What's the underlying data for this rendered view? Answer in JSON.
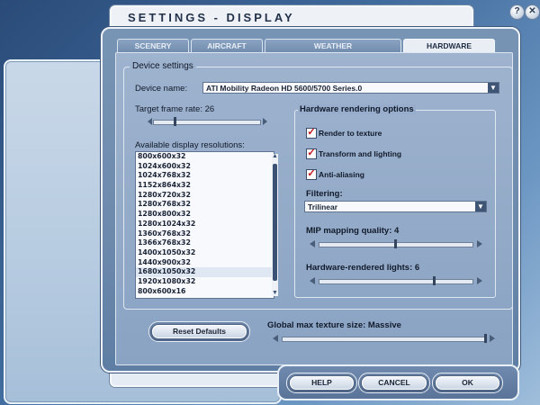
{
  "dialog": {
    "title": "SETTINGS - DISPLAY",
    "help_icon": "question-mark",
    "close_icon": "close-x"
  },
  "tabs": [
    {
      "label": "SCENERY",
      "active": false
    },
    {
      "label": "AIRCRAFT",
      "active": false
    },
    {
      "label": "WEATHER",
      "active": false
    },
    {
      "label": "HARDWARE",
      "active": true
    }
  ],
  "device_settings": {
    "group_label": "Device settings",
    "device_name_label": "Device name:",
    "device_name_value": "ATI Mobility Radeon HD 5600/5700 Series.0",
    "target_frame_rate_label": "Target frame rate: 26",
    "target_frame_rate_level": 0.2,
    "available_resolutions_label": "Available display resolutions:",
    "resolutions": [
      "800x600x32",
      "1024x600x32",
      "1024x768x32",
      "1152x864x32",
      "1280x720x32",
      "1280x768x32",
      "1280x800x32",
      "1280x1024x32",
      "1360x768x32",
      "1366x768x32",
      "1400x1050x32",
      "1440x900x32",
      "1680x1050x32",
      "1920x1080x32",
      "800x600x16"
    ],
    "selected_resolution": "1680x1050x32"
  },
  "hardware_rendering": {
    "group_label": "Hardware rendering options",
    "render_to_texture_label": "Render to texture",
    "render_to_texture_checked": true,
    "transform_lighting_label": "Transform and lighting",
    "transform_lighting_checked": true,
    "anti_aliasing_label": "Anti-aliasing",
    "anti_aliasing_checked": true,
    "filtering_label": "Filtering:",
    "filtering_value": "Trilinear",
    "mip_label": "MIP mapping quality: 4",
    "mip_level": 0.5,
    "lights_label": "Hardware-rendered lights: 6",
    "lights_level": 0.75
  },
  "bottom": {
    "reset_label": "Reset Defaults",
    "texture_label": "Global max texture size: Massive",
    "texture_level": 1.0
  },
  "footer": {
    "help_label": "HELP",
    "cancel_label": "CANCEL",
    "ok_label": "OK"
  },
  "colors": {
    "accent": "#3f5575",
    "check": "#c0141a"
  }
}
